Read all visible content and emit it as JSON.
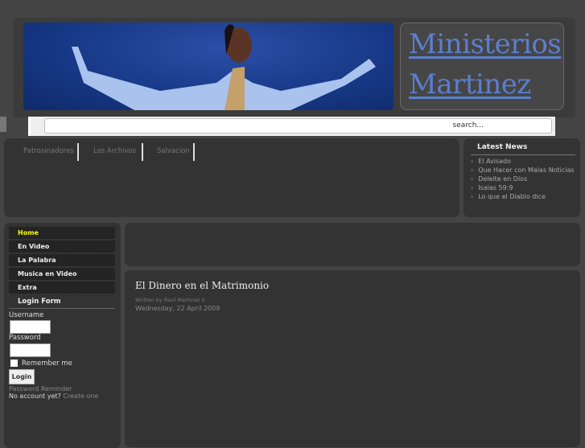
{
  "logo": {
    "line1": "Ministerios",
    "line2": "Martinez"
  },
  "search": {
    "placeholder": "search..."
  },
  "top_nav": [
    "Patrosinadores",
    "Los Archivos",
    "Salvacion"
  ],
  "news": {
    "title": "Latest News",
    "items": [
      "El Avisado",
      "Que Hacer con Malas Noticias",
      "Deleite en Dios",
      "Isaias 59:9",
      "Lo que el Diablo dice"
    ]
  },
  "menu": {
    "items": [
      "Home",
      "En Video",
      "La Palabra",
      "Musica en Video",
      "Extra"
    ]
  },
  "login": {
    "title": "Login Form",
    "username_label": "Username",
    "password_label": "Password",
    "remember_label": "Remember me",
    "button": "Login",
    "reminder": "Password Reminder",
    "no_account": "No account yet?",
    "create": "Create one"
  },
  "article": {
    "title": "El Dinero en el Matrimonio",
    "author": "Written by Raul Martinez II",
    "date": "Wednesday, 22 April 2009"
  },
  "colors": {
    "accent": "#ffff00",
    "logo": "#5b7fd0"
  }
}
